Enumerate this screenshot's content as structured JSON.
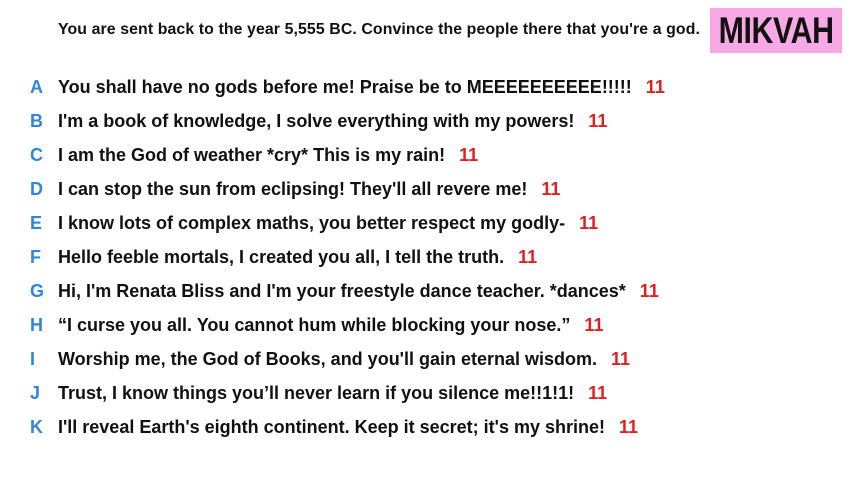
{
  "prompt": "You are sent back to the year 5,555 BC. Convince the people there that you're a god.",
  "badge": {
    "label": "MIKVAH",
    "color": "#f9a8e6"
  },
  "colors": {
    "letter": "#2f86e0",
    "score": "#e02020",
    "text": "#111111"
  },
  "answers": [
    {
      "letter": "A",
      "text": "You shall have no gods before me! Praise be to MEEEEEEEEEE!!!!!",
      "score": "11"
    },
    {
      "letter": "B",
      "text": "I'm a book of knowledge, I solve everything with my powers!",
      "score": "11"
    },
    {
      "letter": "C",
      "text": "I am the God of weather *cry* This is my rain!",
      "score": "11"
    },
    {
      "letter": "D",
      "text": "I can stop the sun from eclipsing! They'll all revere me!",
      "score": "11"
    },
    {
      "letter": "E",
      "text": "I know lots of complex maths, you better respect my godly-",
      "score": "11"
    },
    {
      "letter": "F",
      "text": "Hello feeble mortals, I created you all, I tell the truth.",
      "score": "11"
    },
    {
      "letter": "G",
      "text": "Hi, I'm Renata Bliss and I'm your freestyle dance teacher. *dances*",
      "score": "11"
    },
    {
      "letter": "H",
      "text": "“I curse you all. You cannot hum while blocking your nose.”",
      "score": "11"
    },
    {
      "letter": "I",
      "text": "Worship me, the God of Books, and you'll gain eternal wisdom.",
      "score": "11"
    },
    {
      "letter": "J",
      "text": "Trust, I know things you’ll never learn if you silence me!!1!1!",
      "score": "11"
    },
    {
      "letter": "K",
      "text": "I'll reveal Earth's eighth continent. Keep it secret; it's my shrine!",
      "score": "11"
    }
  ]
}
